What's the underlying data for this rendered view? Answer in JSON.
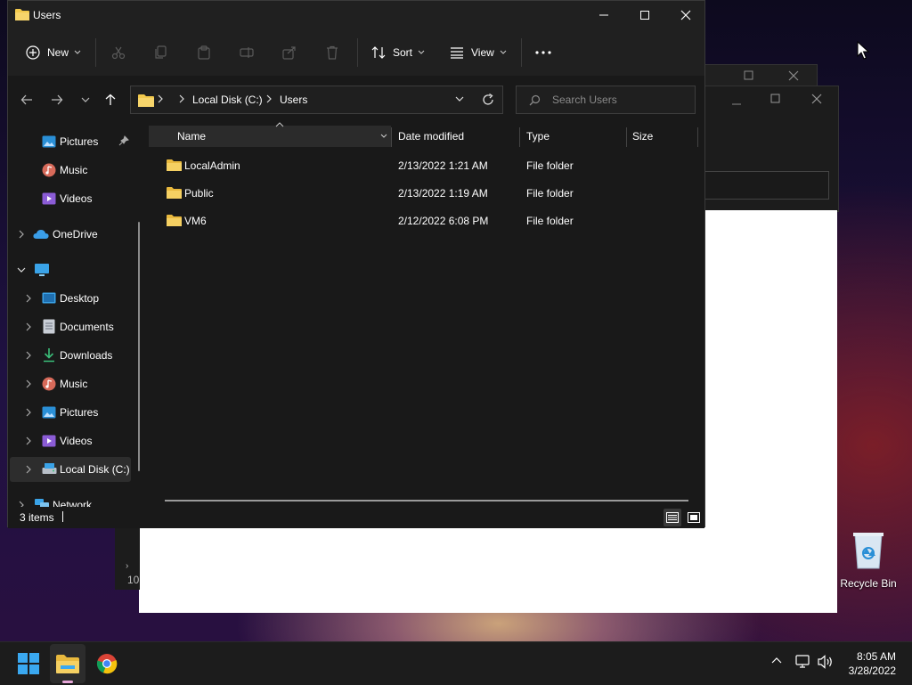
{
  "window": {
    "title": "Users",
    "controls": [
      "minimize-icon",
      "maximize-icon",
      "close-icon"
    ]
  },
  "toolbar": {
    "new_label": "New",
    "sort_label": "Sort",
    "view_label": "View",
    "icons": [
      "cut-icon",
      "copy-icon",
      "paste-icon",
      "rename-icon",
      "share-icon",
      "delete-icon",
      "more-icon"
    ]
  },
  "address": {
    "segments": [
      "Local Disk (C:)",
      "Users"
    ],
    "search_placeholder": "Search Users"
  },
  "nav": {
    "items": [
      {
        "label": "Pictures",
        "icon": "pictures-icon",
        "pinned": true
      },
      {
        "label": "Music",
        "icon": "music-icon"
      },
      {
        "label": "Videos",
        "icon": "videos-icon"
      },
      {
        "label": "OneDrive",
        "icon": "onedrive-icon"
      },
      {
        "label": "",
        "icon": "this-pc-icon"
      },
      {
        "label": "Desktop",
        "icon": "desktop-icon"
      },
      {
        "label": "Documents",
        "icon": "documents-icon"
      },
      {
        "label": "Downloads",
        "icon": "downloads-icon"
      },
      {
        "label": "Music",
        "icon": "music-icon"
      },
      {
        "label": "Pictures",
        "icon": "pictures-icon"
      },
      {
        "label": "Videos",
        "icon": "videos-icon"
      },
      {
        "label": "Local Disk (C:)",
        "icon": "drive-icon",
        "selected": true
      },
      {
        "label": "Network",
        "icon": "network-icon"
      }
    ]
  },
  "table": {
    "columns": [
      "Name",
      "Date modified",
      "Type",
      "Size"
    ],
    "rows": [
      {
        "name": "LocalAdmin",
        "date": "2/13/2022 1:21 AM",
        "type": "File folder",
        "size": ""
      },
      {
        "name": "Public",
        "date": "2/13/2022 1:19 AM",
        "type": "File folder",
        "size": ""
      },
      {
        "name": "VM6",
        "date": "2/12/2022 6:08 PM",
        "type": "File folder",
        "size": ""
      }
    ]
  },
  "status": {
    "item_count": "3 items"
  },
  "background": {
    "partial_text": "10"
  },
  "desktop": {
    "recycle_bin_label": "Recycle Bin"
  },
  "taskbar": {
    "time": "8:05 AM",
    "date": "3/28/2022"
  },
  "colors": {
    "accent": "#0078d4",
    "folder": "#f2c94c",
    "window_bg": "#191919"
  }
}
